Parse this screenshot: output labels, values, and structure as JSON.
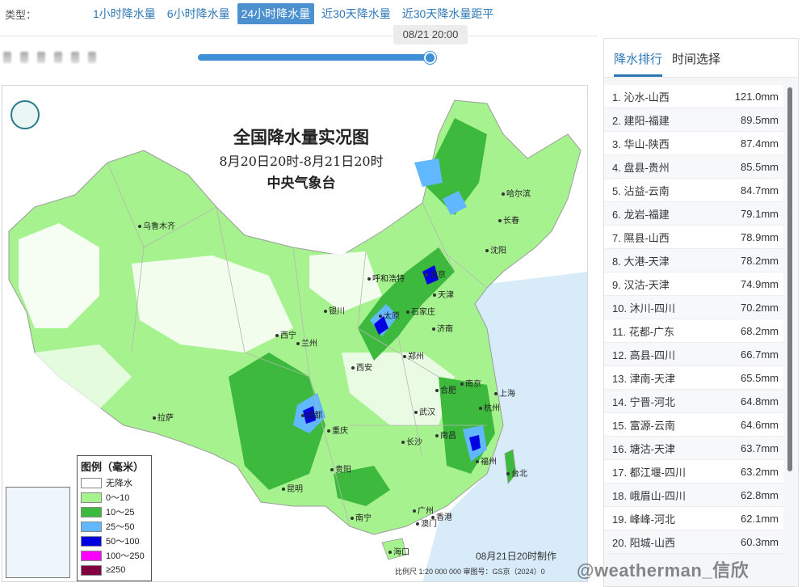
{
  "type_bar": {
    "label": "类型：",
    "tabs": [
      {
        "label": "1小时降水量",
        "active": false
      },
      {
        "label": "6小时降水量",
        "active": false
      },
      {
        "label": "24小时降水量",
        "active": true
      },
      {
        "label": "近30天降水量",
        "active": false
      },
      {
        "label": "近30天降水量距平",
        "active": false
      }
    ]
  },
  "slider": {
    "time_tip": "08/21 20:00",
    "progress": 1.0
  },
  "map": {
    "title": "全国降水量实况图",
    "subtitle": "8月20日20时-8月21日20时",
    "org": "中央气象台",
    "made_at": "08月21日20时制作",
    "scale_text": "比例尺  1:20 000 000    审图号：GS京（2024）0",
    "cities": [
      "乌鲁木齐",
      "哈尔滨",
      "长春",
      "沈阳",
      "呼和浩特",
      "北京",
      "天津",
      "银川",
      "太原",
      "石家庄",
      "济南",
      "西宁",
      "兰州",
      "西安",
      "郑州",
      "拉萨",
      "成都",
      "合肥",
      "南京",
      "上海",
      "杭州",
      "武汉",
      "重庆",
      "长沙",
      "南昌",
      "福州",
      "贵阳",
      "昆明",
      "台北",
      "南宁",
      "广州",
      "澳门",
      "香港",
      "海口"
    ],
    "legend": {
      "title": "图例（毫米）",
      "items": [
        {
          "label": "无降水",
          "color": "#ffffff"
        },
        {
          "label": "0～10",
          "color": "#a6f28f"
        },
        {
          "label": "10～25",
          "color": "#3dba3d"
        },
        {
          "label": "25～50",
          "color": "#61b8ff"
        },
        {
          "label": "50～100",
          "color": "#0000e1"
        },
        {
          "label": "100～250",
          "color": "#fa00fa"
        },
        {
          "label": "≥250",
          "color": "#800040"
        }
      ]
    }
  },
  "rank_panel": {
    "tabs": [
      {
        "label": "降水排行",
        "active": true
      },
      {
        "label": "时间选择",
        "active": false
      }
    ],
    "items": [
      {
        "name": "1. 沁水-山西",
        "value": "121.0mm"
      },
      {
        "name": "2. 建阳-福建",
        "value": "89.5mm"
      },
      {
        "name": "3. 华山-陕西",
        "value": "87.4mm"
      },
      {
        "name": "4. 盘县-贵州",
        "value": "85.5mm"
      },
      {
        "name": "5. 沾益-云南",
        "value": "84.7mm"
      },
      {
        "name": "6. 龙岩-福建",
        "value": "79.1mm"
      },
      {
        "name": "7. 隰县-山西",
        "value": "78.9mm"
      },
      {
        "name": "8. 大港-天津",
        "value": "78.2mm"
      },
      {
        "name": "9. 汉沽-天津",
        "value": "74.9mm"
      },
      {
        "name": "10. 沐川-四川",
        "value": "70.2mm"
      },
      {
        "name": "11. 花都-广东",
        "value": "68.2mm"
      },
      {
        "name": "12. 高县-四川",
        "value": "66.7mm"
      },
      {
        "name": "13. 津南-天津",
        "value": "65.5mm"
      },
      {
        "name": "14. 宁晋-河北",
        "value": "64.8mm"
      },
      {
        "name": "15. 富源-云南",
        "value": "64.6mm"
      },
      {
        "name": "16. 塘沽-天津",
        "value": "63.7mm"
      },
      {
        "name": "17. 都江堰-四川",
        "value": "63.2mm"
      },
      {
        "name": "18. 峨眉山-四川",
        "value": "62.8mm"
      },
      {
        "name": "19. 峰峰-河北",
        "value": "62.1mm"
      },
      {
        "name": "20. 阳城-山西",
        "value": "60.3mm"
      }
    ]
  },
  "watermark": "@weatherman_信欣"
}
